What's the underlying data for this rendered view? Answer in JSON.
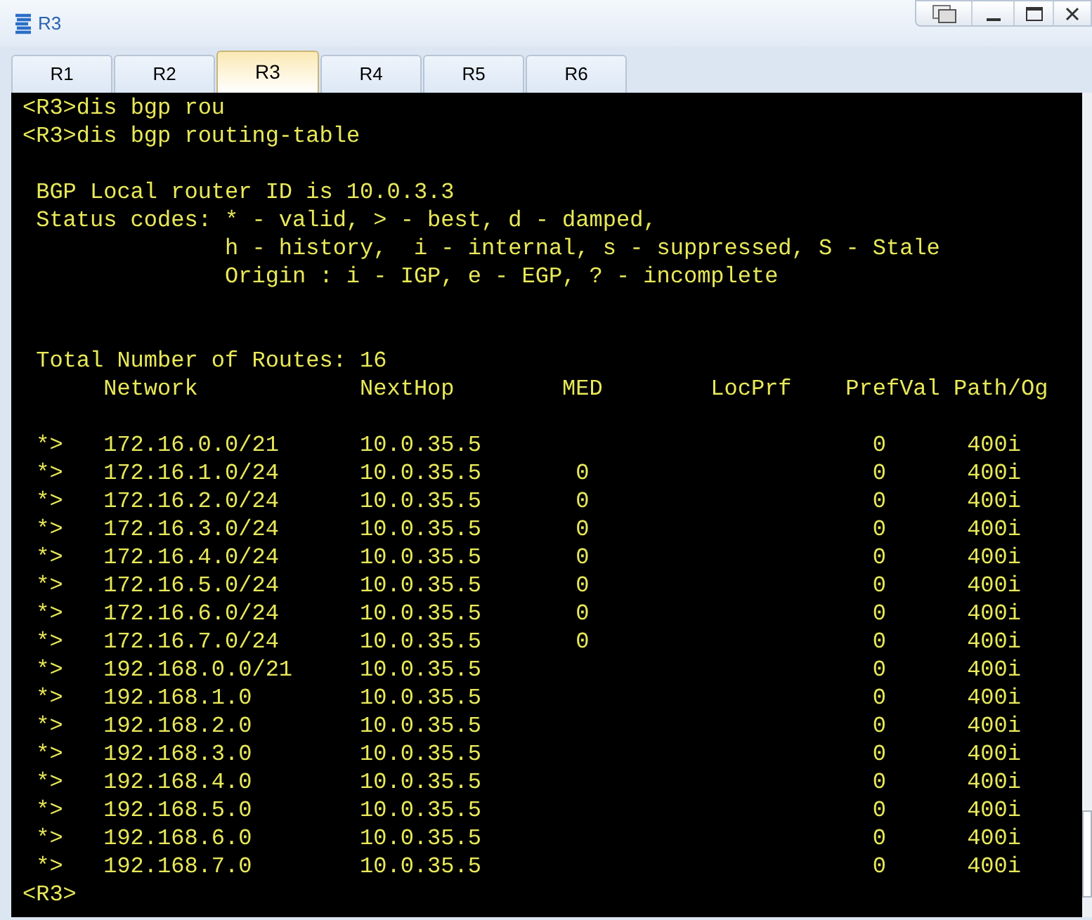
{
  "window": {
    "title": "R3"
  },
  "tabs": [
    {
      "label": "R1",
      "selected": false
    },
    {
      "label": "R2",
      "selected": false
    },
    {
      "label": "R3",
      "selected": true
    },
    {
      "label": "R4",
      "selected": false
    },
    {
      "label": "R5",
      "selected": false
    },
    {
      "label": "R6",
      "selected": false
    }
  ],
  "terminal": {
    "lines_before": [
      {
        "kind": "command",
        "text": "<R3>dis bgp rou"
      },
      {
        "kind": "command",
        "text": "<R3>dis bgp routing-table"
      },
      {
        "kind": "blank"
      },
      {
        "kind": "info",
        "text": "BGP Local router ID is 10.0.3.3"
      },
      {
        "kind": "info",
        "text": "Status codes: * - valid, > - best, d - damped,"
      },
      {
        "kind": "continued",
        "text": "h - history,  i - internal, s - suppressed, S - Stale"
      },
      {
        "kind": "continued",
        "text": "Origin : i - IGP, e - EGP, ? - incomplete"
      },
      {
        "kind": "blank"
      },
      {
        "kind": "blank"
      },
      {
        "kind": "info",
        "text": "Total Number of Routes: 16"
      }
    ],
    "table": {
      "columns": [
        "Network",
        "NextHop",
        "MED",
        "LocPrf",
        "PrefVal",
        "Path/Og"
      ],
      "rows": [
        {
          "status": "*>",
          "network": "172.16.0.0/21",
          "next_hop": "10.0.35.5",
          "pref_val": "0",
          "path": "400i"
        },
        {
          "status": "*>",
          "network": "172.16.1.0/24",
          "next_hop": "10.0.35.5",
          "med": "0",
          "pref_val": "0",
          "path": "400i"
        },
        {
          "status": "*>",
          "network": "172.16.2.0/24",
          "next_hop": "10.0.35.5",
          "med": "0",
          "pref_val": "0",
          "path": "400i"
        },
        {
          "status": "*>",
          "network": "172.16.3.0/24",
          "next_hop": "10.0.35.5",
          "med": "0",
          "pref_val": "0",
          "path": "400i"
        },
        {
          "status": "*>",
          "network": "172.16.4.0/24",
          "next_hop": "10.0.35.5",
          "med": "0",
          "pref_val": "0",
          "path": "400i"
        },
        {
          "status": "*>",
          "network": "172.16.5.0/24",
          "next_hop": "10.0.35.5",
          "med": "0",
          "pref_val": "0",
          "path": "400i"
        },
        {
          "status": "*>",
          "network": "172.16.6.0/24",
          "next_hop": "10.0.35.5",
          "med": "0",
          "pref_val": "0",
          "path": "400i"
        },
        {
          "status": "*>",
          "network": "172.16.7.0/24",
          "next_hop": "10.0.35.5",
          "med": "0",
          "pref_val": "0",
          "path": "400i"
        },
        {
          "status": "*>",
          "network": "192.168.0.0/21",
          "next_hop": "10.0.35.5",
          "pref_val": "0",
          "path": "400i"
        },
        {
          "status": "*>",
          "network": "192.168.1.0",
          "next_hop": "10.0.35.5",
          "pref_val": "0",
          "path": "400i"
        },
        {
          "status": "*>",
          "network": "192.168.2.0",
          "next_hop": "10.0.35.5",
          "pref_val": "0",
          "path": "400i"
        },
        {
          "status": "*>",
          "network": "192.168.3.0",
          "next_hop": "10.0.35.5",
          "pref_val": "0",
          "path": "400i"
        },
        {
          "status": "*>",
          "network": "192.168.4.0",
          "next_hop": "10.0.35.5",
          "pref_val": "0",
          "path": "400i"
        },
        {
          "status": "*>",
          "network": "192.168.5.0",
          "next_hop": "10.0.35.5",
          "pref_val": "0",
          "path": "400i"
        },
        {
          "status": "*>",
          "network": "192.168.6.0",
          "next_hop": "10.0.35.5",
          "pref_val": "0",
          "path": "400i"
        },
        {
          "status": "*>",
          "network": "192.168.7.0",
          "next_hop": "10.0.35.5",
          "pref_val": "0",
          "path": "400i"
        }
      ]
    },
    "prompt": "<R3>"
  }
}
